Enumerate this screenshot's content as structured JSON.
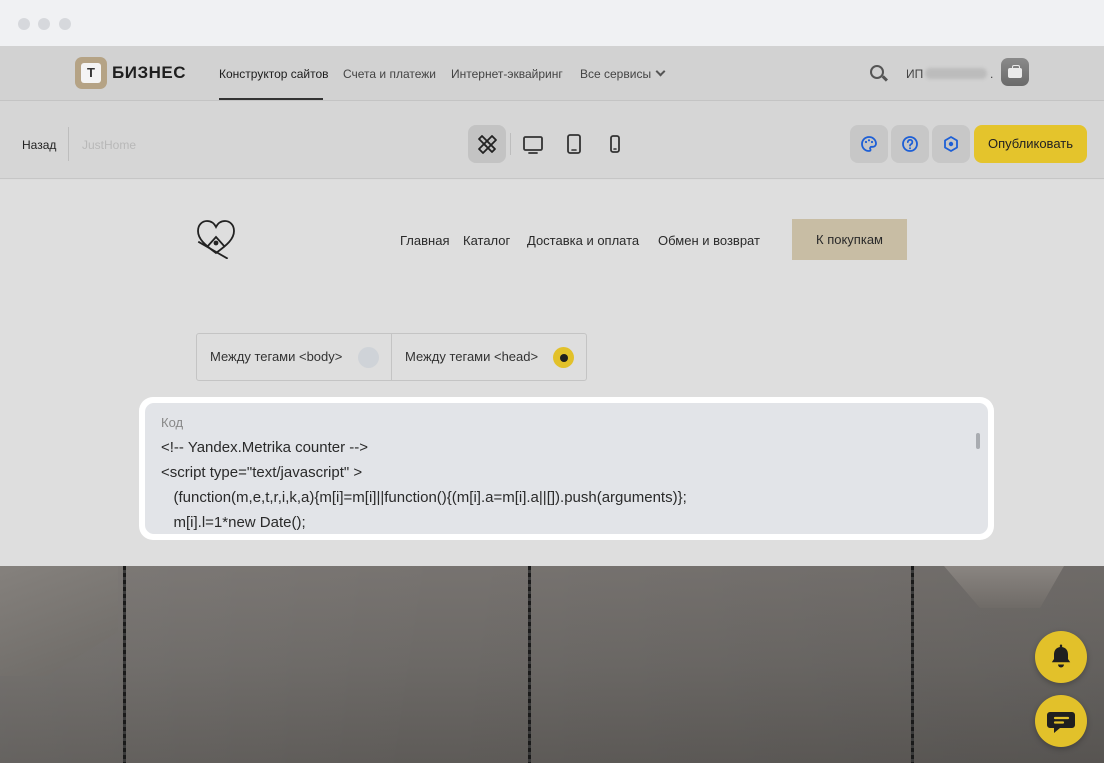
{
  "topnav": {
    "logo_letter": "Т",
    "logo_text": "БИЗНЕС",
    "links": [
      "Конструктор сайтов",
      "Счета и платежи",
      "Интернет-эквайринг",
      "Все сервисы"
    ],
    "user_prefix": "ИП",
    "user_suffix": "."
  },
  "toolbar": {
    "back_label": "Назад",
    "site_name": "JustHome",
    "publish_label": "Опубликовать"
  },
  "site": {
    "nav": [
      "Главная",
      "Каталог",
      "Доставка и оплата",
      "Обмен и возврат"
    ],
    "shop_button": "К покупкам"
  },
  "placement": {
    "options": [
      "Между тегами <body>",
      "Между тегами <head>"
    ],
    "selected_index": 1
  },
  "code": {
    "label": "Код",
    "lines": [
      "<!-- Yandex.Metrika counter -->",
      "<script type=\"text/javascript\" >",
      "   (function(m,e,t,r,i,k,a){m[i]=m[i]||function(){(m[i].a=m[i].a||[]).push(arguments)};",
      "   m[i].l=1*new Date();"
    ]
  },
  "colors": {
    "accent": "#e2c12a",
    "shop_button": "#c8bda4"
  },
  "icons": {
    "toolbar_tools": [
      "design-tools-icon",
      "desktop-icon",
      "tablet-icon",
      "mobile-icon"
    ],
    "toolbar_actions": [
      "palette-icon",
      "help-icon",
      "settings-hex-icon"
    ],
    "floating": [
      "bell-icon",
      "chat-icon"
    ]
  }
}
